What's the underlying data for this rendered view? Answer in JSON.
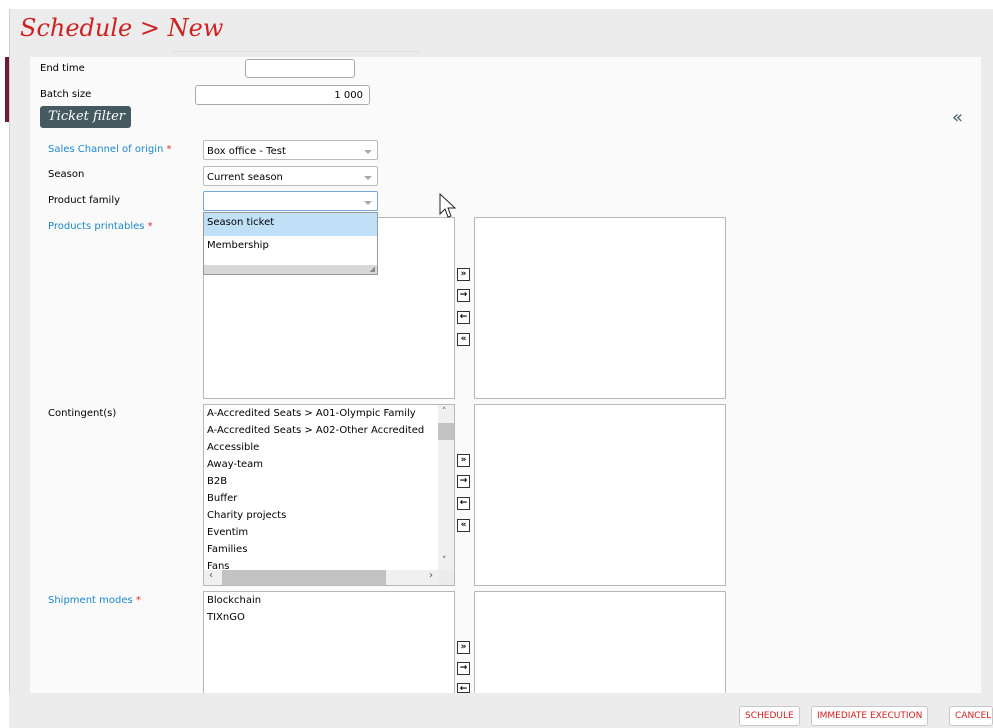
{
  "page": {
    "title": "Schedule > New"
  },
  "form": {
    "end_time_label": "End time",
    "end_time_value": "",
    "batch_size_label": "Batch size",
    "batch_size_value": "1 000",
    "ticket_filter_label": "Ticket filter",
    "collapse_symbol": "«"
  },
  "filters": {
    "sales_channel_label": "Sales Channel of origin",
    "sales_channel_value": "Box office - Test",
    "season_label": "Season",
    "season_value": "Current season",
    "product_family_label": "Product family",
    "product_family_value": "",
    "product_family_options": [
      "Season ticket",
      "Membership"
    ],
    "products_printables_label": "Products printables",
    "contingents_label": "Contingent(s)",
    "contingents_items": [
      "A-Accredited Seats > A01-Olympic Family",
      "A-Accredited Seats > A02-Other Accredited",
      "Accessible",
      "Away-team",
      "B2B",
      "Buffer",
      "Charity projects",
      "Eventim",
      "Families",
      "Fans"
    ],
    "shipment_modes_label": "Shipment modes",
    "shipment_modes_items": [
      "Blockchain",
      "TIXnGO"
    ],
    "required_mark": "*"
  },
  "transfer_buttons": {
    "add_all": "»",
    "add": "→",
    "remove": "←",
    "remove_all": "«"
  },
  "footer": {
    "schedule_label": "SCHEDULE",
    "immediate_label": "IMMEDIATE EXECUTION",
    "cancel_label": "CANCEL"
  },
  "colors": {
    "title": "#cc2222",
    "link_label": "#1e88c8",
    "required": "#e03030",
    "ticket_filter_bg": "#445a60",
    "dropdown_highlight": "#bfe0f6"
  }
}
